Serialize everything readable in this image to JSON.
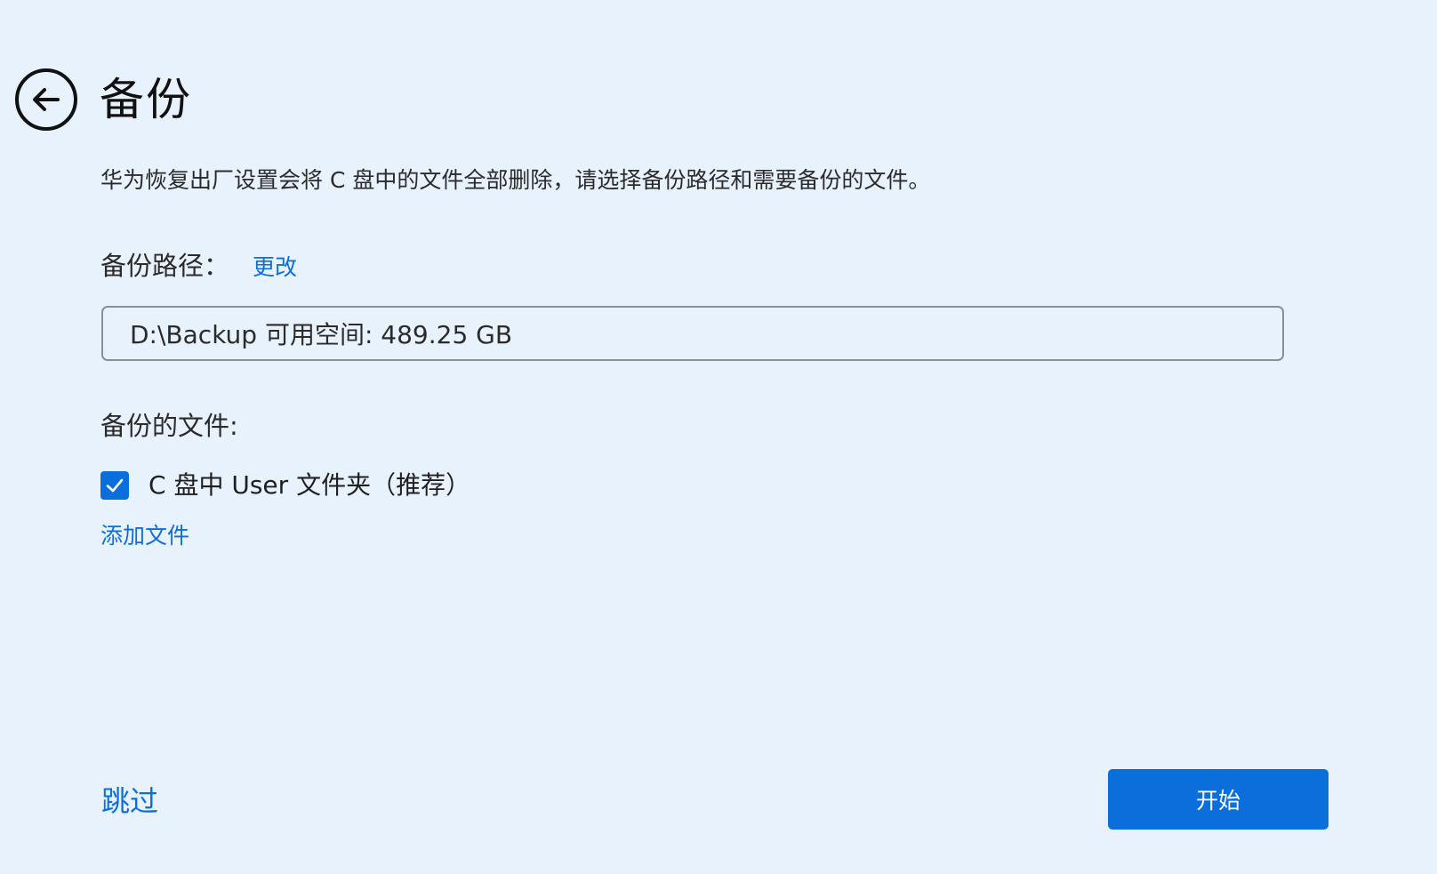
{
  "header": {
    "back_icon": "arrow-left-circle-icon",
    "title": "备份"
  },
  "description": "华为恢复出厂设置会将 C 盘中的文件全部删除，请选择备份路径和需要备份的文件。",
  "backup_path": {
    "label": "备份路径：",
    "change_link": "更改",
    "value": "D:\\Backup 可用空间: 489.25 GB"
  },
  "backup_files": {
    "label": "备份的文件:",
    "items": [
      {
        "label": "C 盘中 User 文件夹（推荐）",
        "checked": true
      }
    ],
    "add_link": "添加文件"
  },
  "footer": {
    "skip_label": "跳过",
    "start_label": "开始"
  },
  "colors": {
    "background": "#e8f2fd",
    "accent": "#0a6fdb",
    "text": "#1f1f1f"
  }
}
